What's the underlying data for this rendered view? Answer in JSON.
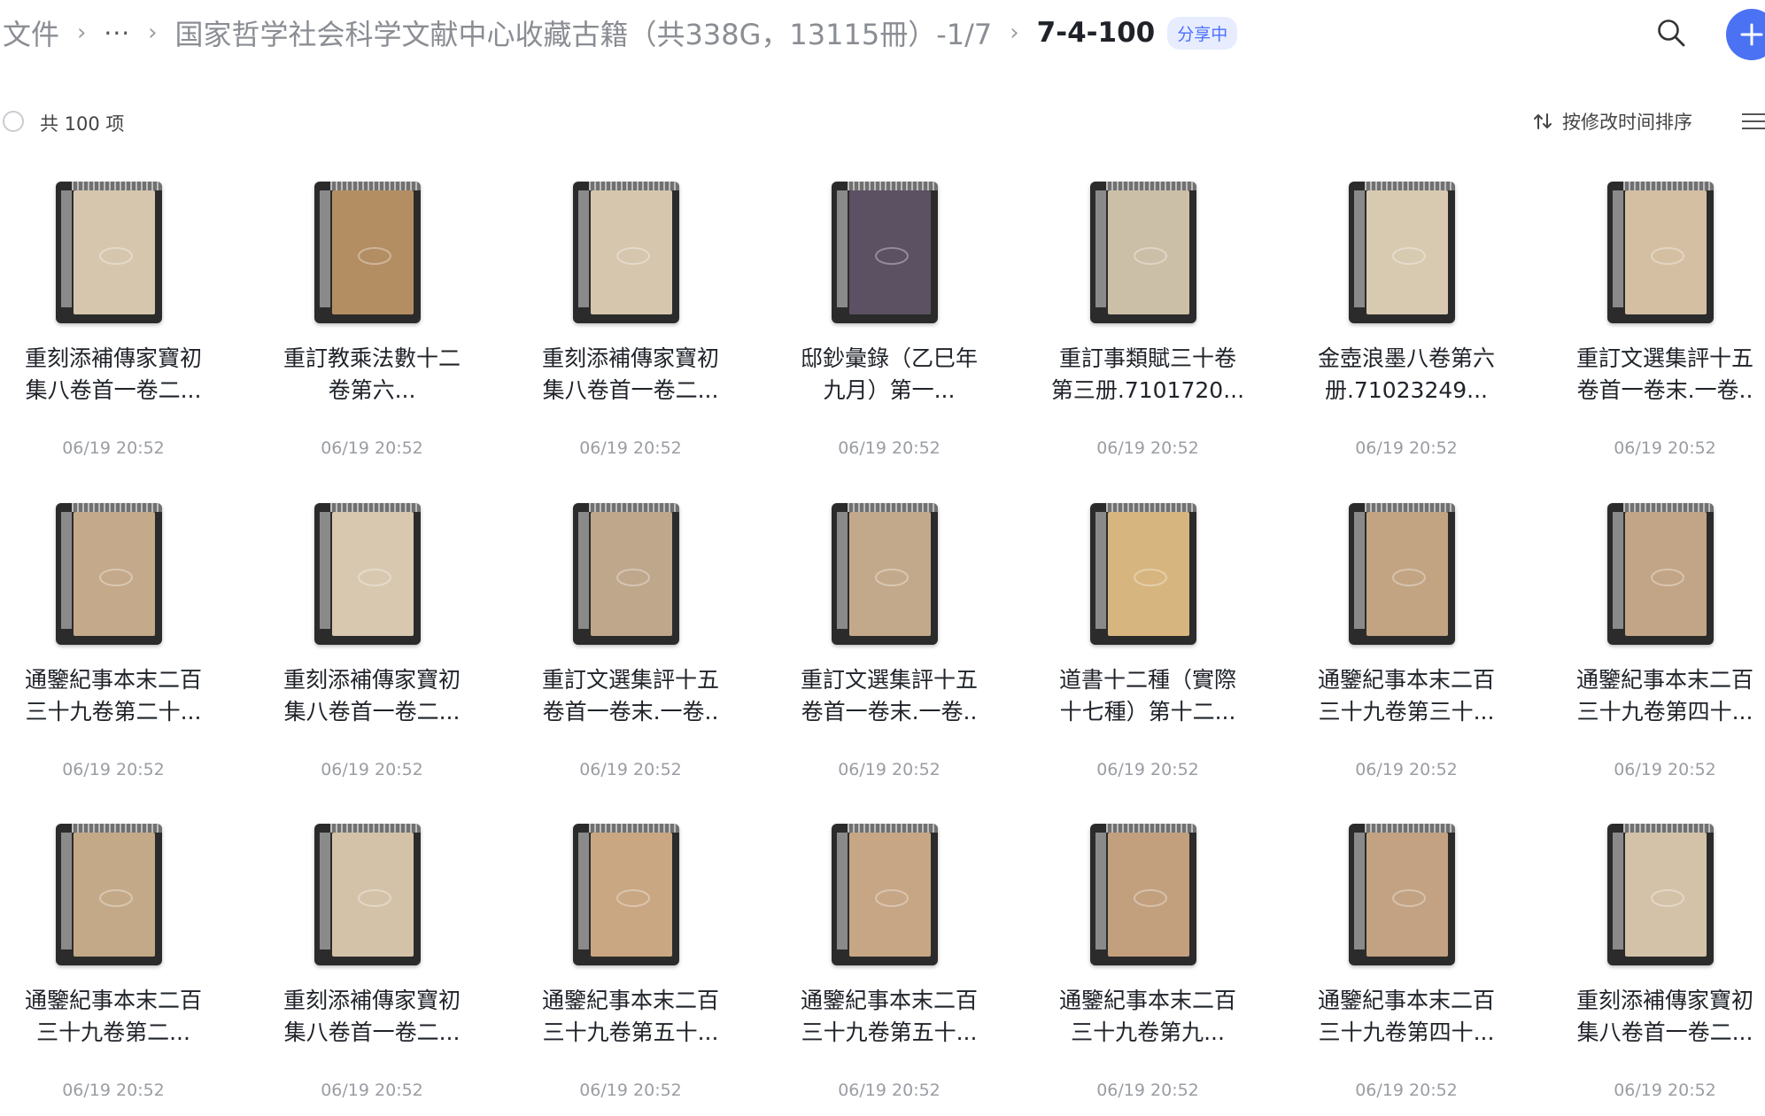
{
  "breadcrumb": {
    "root": "文件",
    "ellipsis": "···",
    "parent": "国家哲学社会科学文献中心收藏古籍（共338G，13115冊）-1/7",
    "current": "7-4-100",
    "status_badge": "分享中"
  },
  "toolbar": {
    "item_count": "共 100 项",
    "sort_label": "按修改时间排序"
  },
  "colors": {
    "accent": "#4b72f3",
    "badge_bg": "#e7edff",
    "badge_text": "#4c6fff"
  },
  "files": [
    {
      "line1": "重刻添補傳家寶初",
      "line2": "集八卷首一卷二...",
      "date": "06/19 20:52",
      "cover": "#d6c6ae"
    },
    {
      "line1": "重訂教乘法數十二",
      "line2": "卷第六...",
      "date": "06/19 20:52",
      "cover": "#b48e63"
    },
    {
      "line1": "重刻添補傳家寶初",
      "line2": "集八卷首一卷二...",
      "date": "06/19 20:52",
      "cover": "#d6c6ae"
    },
    {
      "line1": "邸鈔彙錄（乙巳年",
      "line2": "九月）第一...",
      "date": "06/19 20:52",
      "cover": "#5b5163"
    },
    {
      "line1": "重訂事類賦三十卷",
      "line2": "第三册.7101720...",
      "date": "06/19 20:52",
      "cover": "#ccbfa7"
    },
    {
      "line1": "金壺浪墨八卷第六",
      "line2": "册.71023249...",
      "date": "06/19 20:52",
      "cover": "#d8c9b1"
    },
    {
      "line1": "重訂文選集評十五",
      "line2": "卷首一卷末.一卷..",
      "date": "06/19 20:52",
      "cover": "#d4bfa3"
    },
    {
      "line1": "通鑒紀事本末二百",
      "line2": "三十九卷第二十...",
      "date": "06/19 20:52",
      "cover": "#c4a98a"
    },
    {
      "line1": "重刻添補傳家寶初",
      "line2": "集八卷首一卷二...",
      "date": "06/19 20:52",
      "cover": "#d8c8af"
    },
    {
      "line1": "重訂文選集評十五",
      "line2": "卷首一卷末.一卷..",
      "date": "06/19 20:52",
      "cover": "#bfa78c"
    },
    {
      "line1": "重訂文選集評十五",
      "line2": "卷首一卷末.一卷..",
      "date": "06/19 20:52",
      "cover": "#c3a98b"
    },
    {
      "line1": "道書十二種（實際",
      "line2": "十七種）第十二...",
      "date": "06/19 20:52",
      "cover": "#d7b57e"
    },
    {
      "line1": "通鑒紀事本末二百",
      "line2": "三十九卷第三十...",
      "date": "06/19 20:52",
      "cover": "#c2a482"
    },
    {
      "line1": "通鑒紀事本末二百",
      "line2": "三十九卷第四十...",
      "date": "06/19 20:52",
      "cover": "#c2a586"
    },
    {
      "line1": "通鑒紀事本末二百",
      "line2": "三十九卷第二...",
      "date": "06/19 20:52",
      "cover": "#c4a988"
    },
    {
      "line1": "重刻添補傳家寶初",
      "line2": "集八卷首一卷二...",
      "date": "06/19 20:52",
      "cover": "#d4c2a8"
    },
    {
      "line1": "通鑒紀事本末二百",
      "line2": "三十九卷第五十...",
      "date": "06/19 20:52",
      "cover": "#c9a783"
    },
    {
      "line1": "通鑒紀事本末二百",
      "line2": "三十九卷第五十...",
      "date": "06/19 20:52",
      "cover": "#c6a685"
    },
    {
      "line1": "通鑒紀事本末二百",
      "line2": "三十九卷第九...",
      "date": "06/19 20:52",
      "cover": "#c2a07e"
    },
    {
      "line1": "通鑒紀事本末二百",
      "line2": "三十九卷第四十...",
      "date": "06/19 20:52",
      "cover": "#c2a282"
    },
    {
      "line1": "重刻添補傳家寶初",
      "line2": "集八卷首一卷二...",
      "date": "06/19 20:52",
      "cover": "#d4c2a8"
    }
  ]
}
